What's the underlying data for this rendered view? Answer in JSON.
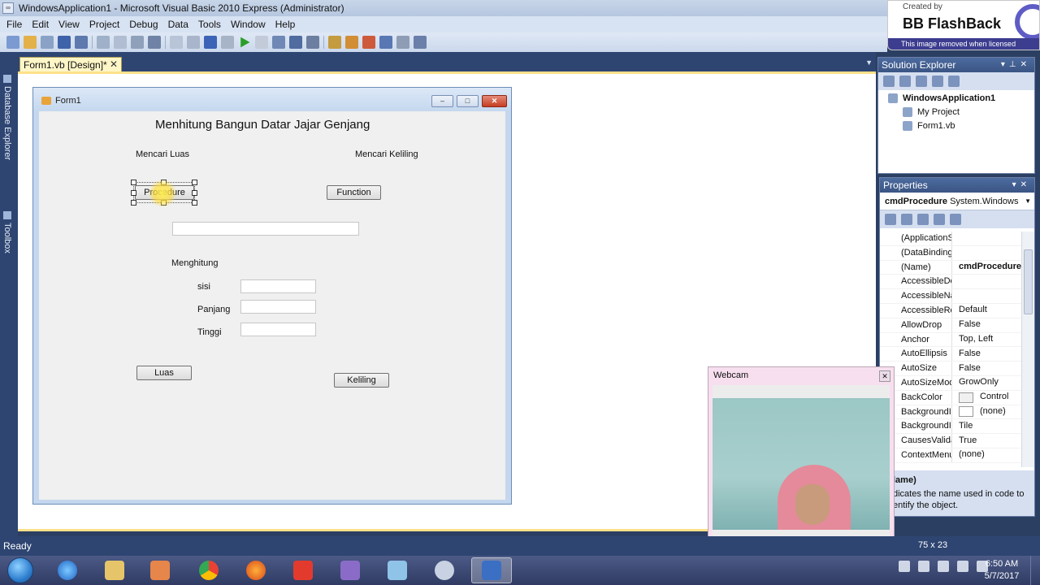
{
  "window": {
    "title": "WindowsApplication1 - Microsoft Visual Basic 2010 Express (Administrator)"
  },
  "watermark": {
    "created_by": "Created by",
    "brand": "BB FlashBack",
    "notice": "This image removed when licensed"
  },
  "menu": [
    "File",
    "Edit",
    "View",
    "Project",
    "Debug",
    "Data",
    "Tools",
    "Window",
    "Help"
  ],
  "side_tabs": {
    "database_explorer": "Database Explorer",
    "toolbox": "Toolbox"
  },
  "document_tab": {
    "label": "Form1.vb [Design]*",
    "close": "✕"
  },
  "form": {
    "title": "Form1",
    "heading": "Menhitung Bangun Datar Jajar Genjang",
    "label_luas": "Mencari Luas",
    "label_keliling": "Mencari Keliling",
    "btn_procedure": "Procedure",
    "btn_function": "Function",
    "label_menghitung": "Menghitung",
    "label_sisi": "sisi",
    "label_panjang": "Panjang",
    "label_tinggi": "Tinggi",
    "btn_luas": "Luas",
    "btn_keliling": "Keliling"
  },
  "solution_explorer": {
    "title": "Solution Explorer",
    "items": [
      "WindowsApplication1",
      "My Project",
      "Form1.vb"
    ]
  },
  "properties": {
    "title": "Properties",
    "object_name": "cmdProcedure",
    "object_type": "System.Windows",
    "rows": [
      {
        "name": "(ApplicationS",
        "value": ""
      },
      {
        "name": "(DataBinding",
        "value": ""
      },
      {
        "name": "(Name)",
        "value": "cmdProcedure"
      },
      {
        "name": "AccessibleDe",
        "value": ""
      },
      {
        "name": "AccessibleNa",
        "value": ""
      },
      {
        "name": "AccessibleRo",
        "value": "Default"
      },
      {
        "name": "AllowDrop",
        "value": "False"
      },
      {
        "name": "Anchor",
        "value": "Top, Left"
      },
      {
        "name": "AutoEllipsis",
        "value": "False"
      },
      {
        "name": "AutoSize",
        "value": "False"
      },
      {
        "name": "AutoSizeMod",
        "value": "GrowOnly"
      },
      {
        "name": "BackColor",
        "value": "Control"
      },
      {
        "name": "BackgroundI",
        "value": "(none)"
      },
      {
        "name": "BackgroundI",
        "value": "Tile"
      },
      {
        "name": "CausesValida",
        "value": "True"
      },
      {
        "name": "ContextMenu",
        "value": "(none)"
      }
    ],
    "desc_title": "lame)",
    "desc_line1": "dicates the name used in code to",
    "desc_line2": "entify the object."
  },
  "webcam": {
    "title": "Webcam"
  },
  "status": {
    "text": "Ready",
    "size": "75 x 23"
  },
  "clock": {
    "time": "6:50 AM",
    "date": "5/7/2017"
  }
}
